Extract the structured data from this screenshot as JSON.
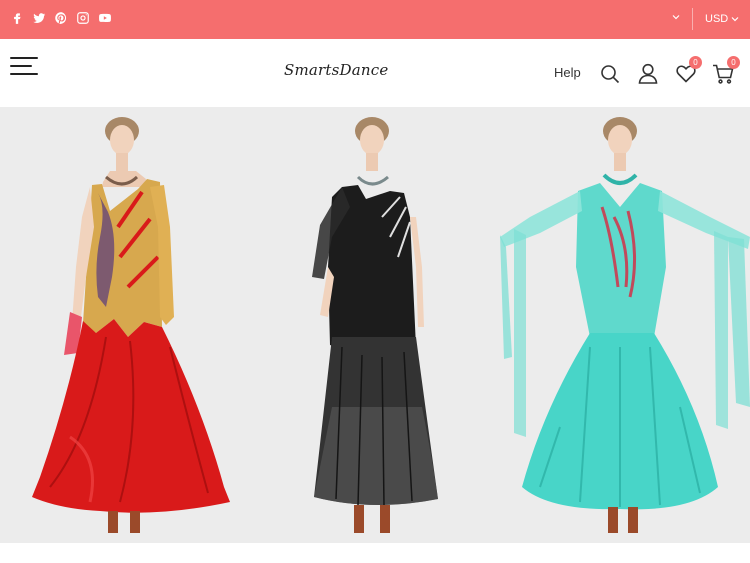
{
  "topbar": {
    "social_icons": [
      "facebook-icon",
      "twitter-icon",
      "pinterest-icon",
      "instagram-icon",
      "youtube-icon"
    ],
    "currency": "USD",
    "background": "#f56e6e"
  },
  "header": {
    "logo": "SmartsDance",
    "help_label": "Help",
    "wishlist_count": "0",
    "cart_count": "0"
  },
  "products": [
    {
      "name": "red-gold-dress",
      "colors": {
        "top": "#d7a84e",
        "skirt": "#d91a1a"
      }
    },
    {
      "name": "black-dress",
      "colors": {
        "top": "#1c1c1c",
        "skirt": "#333333"
      }
    },
    {
      "name": "turquoise-dress",
      "colors": {
        "top": "#5fd9cc",
        "skirt": "#48d5c8"
      }
    }
  ]
}
